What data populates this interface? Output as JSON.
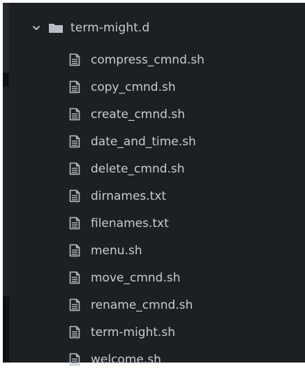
{
  "tree": {
    "folder": {
      "name": "term-might.d",
      "expanded": true,
      "icon": "folder-icon",
      "chevron_icon": "chevron-down-icon"
    },
    "files": [
      {
        "name": "compress_cmnd.sh",
        "icon": "file-text-icon"
      },
      {
        "name": "copy_cmnd.sh",
        "icon": "file-text-icon"
      },
      {
        "name": "create_cmnd.sh",
        "icon": "file-text-icon"
      },
      {
        "name": "date_and_time.sh",
        "icon": "file-text-icon"
      },
      {
        "name": "delete_cmnd.sh",
        "icon": "file-text-icon"
      },
      {
        "name": "dirnames.txt",
        "icon": "file-text-icon"
      },
      {
        "name": "filenames.txt",
        "icon": "file-text-icon"
      },
      {
        "name": "menu.sh",
        "icon": "file-text-icon"
      },
      {
        "name": "move_cmnd.sh",
        "icon": "file-text-icon"
      },
      {
        "name": "rename_cmnd.sh",
        "icon": "file-text-icon"
      },
      {
        "name": "term-might.sh",
        "icon": "file-text-icon"
      },
      {
        "name": "welcome.sh",
        "icon": "file-text-icon"
      }
    ]
  },
  "colors": {
    "background": "#1c2024",
    "text": "#c8ccd1",
    "icon": "#b9bec4"
  }
}
